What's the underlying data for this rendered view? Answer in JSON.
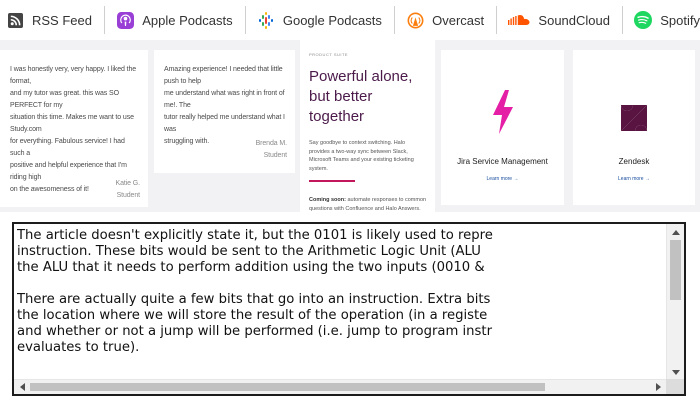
{
  "podcast_links": [
    {
      "label": "RSS Feed",
      "icon": "rss-icon",
      "color": "#444444"
    },
    {
      "label": "Apple Podcasts",
      "icon": "apple-podcasts-icon",
      "color": "#9a3fd6"
    },
    {
      "label": "Google Podcasts",
      "icon": "google-podcasts-icon",
      "color": "#4285f4"
    },
    {
      "label": "Overcast",
      "icon": "overcast-icon",
      "color": "#fc7e0f"
    },
    {
      "label": "SoundCloud",
      "icon": "soundcloud-icon",
      "color": "#ff5500"
    },
    {
      "label": "Spotify",
      "icon": "spotify-icon",
      "color": "#1ed760"
    }
  ],
  "reviews": [
    {
      "lines": [
        "I was honestly very, very happy. I liked the format,",
        "and my tutor was great. this was SO PERFECT for my",
        "situation this time. Makes me want to use Study.com",
        "for everything. Fabulous service! I had such a",
        "positive and helpful experience that I'm riding high",
        "on the awesomeness of it!"
      ],
      "author_name": "Katie G.",
      "author_role": "Student"
    },
    {
      "lines": [
        "Amazing experience! I needed that little push to help",
        "me understand what was right in front of me!. The",
        "tutor really helped me understand what I was",
        "struggling with."
      ],
      "author_name": "Brenda M.",
      "author_role": "Student"
    }
  ],
  "promo": {
    "eyebrow": "PRODUCT SUITE",
    "heading": "Powerful alone, but better together",
    "description": "Say goodbye to context switching. Halo provides a two-way sync between Slack, Microsoft Teams and your existing ticketing system.",
    "coming_soon_label": "Coming soon:",
    "coming_soon_text": " automate responses to common questions with Confluence and Halo Answers."
  },
  "integrations": [
    {
      "name": "Jira Service Management",
      "icon": "jira-service-management-icon",
      "link": "Learn more →",
      "color": "#e41fa5"
    },
    {
      "name": "Zendesk",
      "icon": "zendesk-icon",
      "link": "Learn more →",
      "color": "#5a1442"
    }
  ],
  "article_text": {
    "paragraph1": [
      "The article doesn't explicitly state it, but the 0101 is likely used to repre",
      "instruction. These bits would be sent to the Arithmetic Logic Unit (ALU",
      "the ALU that it needs to perform addition using the two inputs (0010 &"
    ],
    "paragraph2": [
      "There are actually quite a few bits that go into an instruction. Extra bits",
      "the location where we will store the result of the operation (in a registe",
      "and whether or not a jump will be performed (i.e. jump to program instr",
      "evaluates to true)."
    ]
  },
  "colors": {
    "strip_background": "#f2f2f4",
    "promo_heading": "#4b1a4a",
    "promo_rule": "#c2185b",
    "link": "#1a4fa0"
  }
}
